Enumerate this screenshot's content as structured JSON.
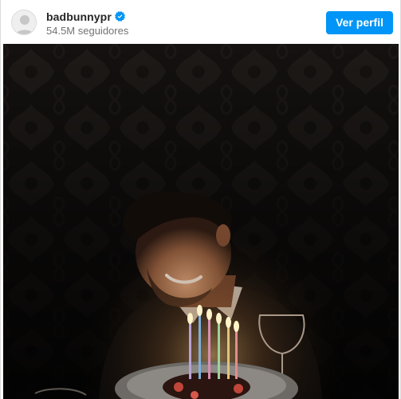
{
  "post": {
    "username": "badbunnypr",
    "verified": true,
    "followers_text": "54.5M seguidores",
    "view_profile_label": "Ver perfil",
    "accent_color": "#0095f6",
    "verified_color": "#0095f6"
  },
  "media": {
    "type": "photo",
    "description_icon": "photo-image"
  }
}
